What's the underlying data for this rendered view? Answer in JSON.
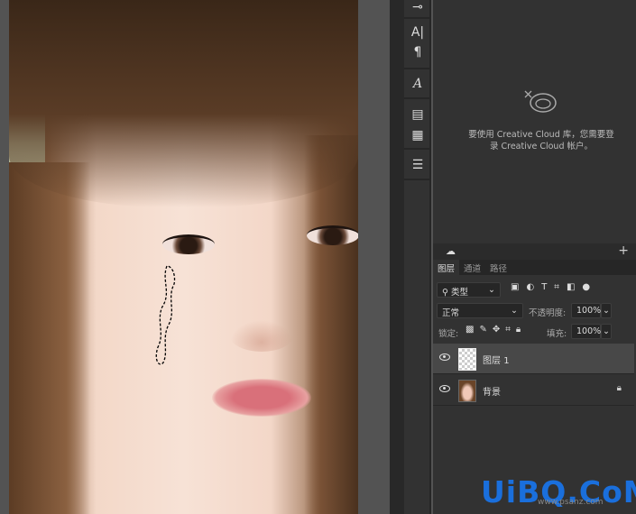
{
  "canvas": {
    "description_layer": "photo"
  },
  "toolbar_icons": [
    "adjust-sliders-icon",
    "character-icon",
    "paragraph-icon",
    "glyphs-icon",
    "layout-icon",
    "notes-icon",
    "properties-icon"
  ],
  "libraries": {
    "message_line1": "要使用 Creative Cloud 库，您需要登",
    "message_line2": "录 Creative Cloud 帐户。"
  },
  "layers_panel": {
    "tabs": [
      {
        "label": "图层",
        "active": true
      },
      {
        "label": "通道"
      },
      {
        "label": "路径"
      }
    ],
    "filter": {
      "label": "类型"
    },
    "blend_mode": "正常",
    "opacity_label": "不透明度:",
    "opacity": "100%",
    "lock_label": "锁定:",
    "fill_label": "填充:",
    "fill": "100%",
    "layers": [
      {
        "name": "图层",
        "index": "1",
        "selected": true
      },
      {
        "name": "背景",
        "locked": true
      }
    ]
  },
  "watermark": {
    "text": "UiBQ.CoM",
    "sub": "www.psanz.com"
  },
  "colors": {
    "panel": "#323232",
    "canvas_bg": "#535353",
    "watermark": "#1a6fdc"
  }
}
